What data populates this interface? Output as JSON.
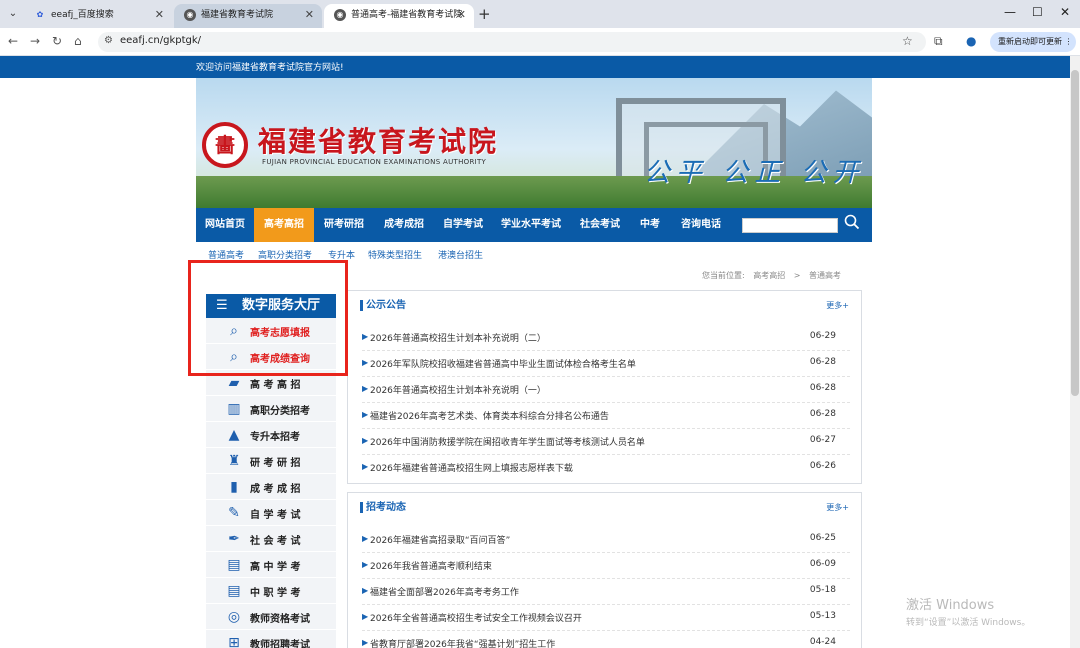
{
  "browser": {
    "tabs": [
      {
        "label": "eeafj_百度搜索"
      },
      {
        "label": "福建省教育考试院"
      },
      {
        "label": "普通高考-福建省教育考试院"
      }
    ],
    "url": "eeafj.cn/gkptgk/",
    "update_button": "重新启动即可更新"
  },
  "site": {
    "welcome": "欢迎访问福建省教育考试院官方网站!",
    "org_name_cn": "福建省教育考试院",
    "org_name_en": "FUJIAN PROVINCIAL EDUCATION EXAMINATIONS AUTHORITY",
    "seal_char": "畵",
    "slogan": "公平 公正 公开"
  },
  "main_nav": [
    "网站首页",
    "高考高招",
    "研考研招",
    "成考成招",
    "自学考试",
    "学业水平考试",
    "社会考试",
    "中考",
    "咨询电话"
  ],
  "sub_nav": [
    "普通高考",
    "高职分类招考",
    "专升本",
    "特殊类型招生",
    "港澳台招生"
  ],
  "breadcrumb": {
    "prefix": "您当前位置:",
    "level1": "高考高招",
    "sep": ">",
    "level2": "普通高考"
  },
  "sidebar": {
    "heading": "数字服务大厅",
    "items": [
      {
        "label": "高考志愿填报",
        "icon": "query-icon"
      },
      {
        "label": "高考成绩查询",
        "icon": "query-icon"
      },
      {
        "label": "高 考 高 招",
        "icon": "folder-icon"
      },
      {
        "label": "高职分类招考",
        "icon": "books-icon"
      },
      {
        "label": "专升本招考",
        "icon": "graduation-cap-icon"
      },
      {
        "label": "研 考 研 招",
        "icon": "scholar-icon"
      },
      {
        "label": "成 考 成 招",
        "icon": "notebook-icon"
      },
      {
        "label": "自 学 考 试",
        "icon": "pen-icon"
      },
      {
        "label": "社 会 考 试",
        "icon": "quill-icon"
      },
      {
        "label": "高 中 学 考",
        "icon": "book-icon"
      },
      {
        "label": "中 职 学 考",
        "icon": "book-icon"
      },
      {
        "label": "教师资格考试",
        "icon": "badge-icon"
      },
      {
        "label": "教师招聘考试",
        "icon": "org-chart-icon"
      }
    ]
  },
  "notice_panel": {
    "title": "公示公告",
    "more": "更多+",
    "rows": [
      {
        "title": "2026年普通高校招生计划本补充说明（二）",
        "date": "06-29"
      },
      {
        "title": "2026年军队院校招收福建省普通高中毕业生面试体检合格考生名单",
        "date": "06-28"
      },
      {
        "title": "2026年普通高校招生计划本补充说明（一）",
        "date": "06-28"
      },
      {
        "title": "福建省2026年高考艺术类、体育类本科综合分排名公布通告",
        "date": "06-28"
      },
      {
        "title": "2026年中国消防救援学院在闽招收青年学生面试等考核测试人员名单",
        "date": "06-27"
      },
      {
        "title": "2026年福建省普通高校招生网上填报志愿样表下载",
        "date": "06-26"
      }
    ]
  },
  "news_panel": {
    "title": "招考动态",
    "more": "更多+",
    "rows": [
      {
        "title": "2026年福建省高招录取“百问百答”",
        "date": "06-25"
      },
      {
        "title": "2026年我省普通高考顺利结束",
        "date": "06-09"
      },
      {
        "title": "福建省全面部署2026年高考考务工作",
        "date": "05-18"
      },
      {
        "title": "2026年全省普通高校招生考试安全工作视频会议召开",
        "date": "05-13"
      },
      {
        "title": "省教育厅部署2026年我省“强基计划”招生工作",
        "date": "04-24"
      }
    ]
  },
  "os": {
    "activate_title": "激活 Windows",
    "activate_hint": "转到“设置”以激活 Windows。"
  }
}
